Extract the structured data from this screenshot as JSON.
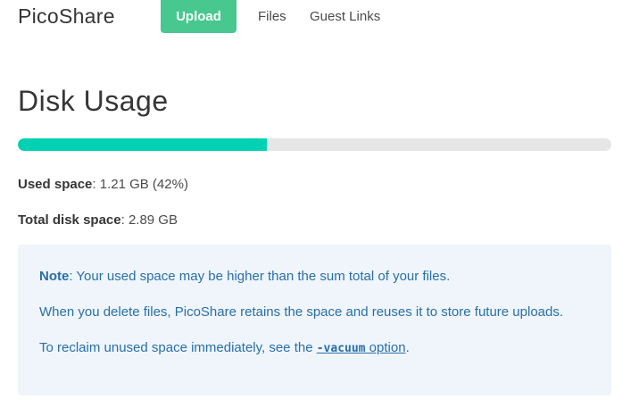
{
  "navbar": {
    "brand": "PicoShare",
    "upload_label": "Upload",
    "files_label": "Files",
    "guest_links_label": "Guest Links",
    "upload_color": "#48c78e"
  },
  "page": {
    "title": "Disk Usage"
  },
  "usage": {
    "progress_percent": 42,
    "progress_color": "#00d1b2",
    "used_label": "Used space",
    "used_value": ": 1.21 GB (42%)",
    "total_label": "Total disk space",
    "total_value": ": 2.89 GB"
  },
  "notification": {
    "note_label": "Note",
    "note_text": ": Your used space may be higher than the sum total of your files.",
    "delete_text": "When you delete files, PicoShare retains the space and reuses it to store future uploads.",
    "reclaim_prefix": "To reclaim unused space immediately, see the ",
    "vacuum_code": "-vacuum",
    "vacuum_link_suffix": " option",
    "reclaim_suffix": "."
  }
}
